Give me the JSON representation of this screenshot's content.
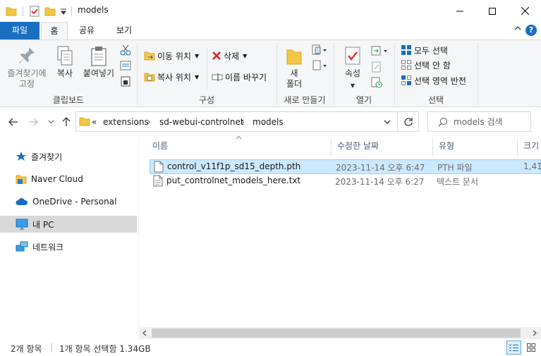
{
  "window": {
    "title": "models",
    "minimize_icon": "minimize-icon",
    "maximize_icon": "maximize-icon",
    "close_icon": "close-icon"
  },
  "ribbon_tabs": [
    {
      "label": "파일"
    },
    {
      "label": "홈"
    },
    {
      "label": "공유"
    },
    {
      "label": "보기"
    }
  ],
  "ribbon": {
    "clipboard": {
      "pin_label": "즐겨찾기에\n고정",
      "copy_label": "복사",
      "paste_label": "붙여넣기",
      "group_label": "클립보드"
    },
    "organize": {
      "move_to": "이동 위치",
      "copy_to": "복사 위치",
      "delete": "삭제",
      "rename": "이름 바꾸기",
      "group_label": "구성"
    },
    "new": {
      "new_folder": "새\n폴더",
      "group_label": "새로 만들기"
    },
    "open": {
      "properties": "속성",
      "group_label": "열기"
    },
    "select": {
      "select_all": "모두 선택",
      "select_none": "선택 안 함",
      "invert": "선택 영역 반전",
      "group_label": "선택"
    }
  },
  "address": {
    "overflow": "«",
    "crumbs": [
      "extensions",
      "sd-webui-controlnet",
      "models"
    ],
    "search_placeholder": "models 검색"
  },
  "nav_pane": [
    {
      "label": "즐겨찾기",
      "icon": "star-icon"
    },
    {
      "label": "Naver Cloud",
      "icon": "cloud-folder-icon"
    },
    {
      "label": "OneDrive - Personal",
      "icon": "onedrive-icon"
    },
    {
      "label": "내 PC",
      "icon": "pc-icon",
      "selected": true
    },
    {
      "label": "네트워크",
      "icon": "network-icon"
    }
  ],
  "columns": [
    "이름",
    "수정한 날짜",
    "유형",
    "크기"
  ],
  "files": [
    {
      "name": "control_v11f1p_sd15_depth.pth",
      "date": "2023-11-14 오후 6:47",
      "type": "PTH 파일",
      "size": "1,41",
      "selected": true
    },
    {
      "name": "put_controlnet_models_here.txt",
      "date": "2023-11-14 오후 6:27",
      "type": "텍스트 문서",
      "size": "",
      "selected": false
    }
  ],
  "status": {
    "count": "2개 항목",
    "selection": "1개 항목 선택함 1.34GB"
  }
}
